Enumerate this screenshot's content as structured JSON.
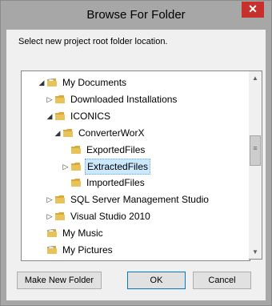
{
  "window": {
    "title": "Browse For Folder",
    "close_glyph": "✕"
  },
  "instruction": "Select new project root folder location.",
  "tree": [
    {
      "label": "My Documents",
      "expander": "◢",
      "icon": "documents-folder-icon",
      "selected": false
    },
    {
      "label": "Downloaded Installations",
      "expander": "▷",
      "icon": "folder-icon",
      "selected": false
    },
    {
      "label": "ICONICS",
      "expander": "◢",
      "icon": "folder-icon",
      "selected": false
    },
    {
      "label": "ConverterWorX",
      "expander": "◢",
      "icon": "folder-icon",
      "selected": false
    },
    {
      "label": "ExportedFiles",
      "expander": "",
      "icon": "folder-icon",
      "selected": false
    },
    {
      "label": "ExtractedFiles",
      "expander": "▷",
      "icon": "folder-icon",
      "selected": true
    },
    {
      "label": "ImportedFiles",
      "expander": "",
      "icon": "folder-icon",
      "selected": false
    },
    {
      "label": "SQL Server Management Studio",
      "expander": "▷",
      "icon": "folder-icon",
      "selected": false
    },
    {
      "label": "Visual Studio 2010",
      "expander": "▷",
      "icon": "folder-icon",
      "selected": false
    },
    {
      "label": "My Music",
      "expander": "",
      "icon": "music-folder-icon",
      "selected": false
    },
    {
      "label": "My Pictures",
      "expander": "",
      "icon": "pictures-folder-icon",
      "selected": false
    }
  ],
  "scrollbar": {
    "up_glyph": "▲",
    "down_glyph": "▼",
    "grip_glyph": "≡"
  },
  "buttons": {
    "new_folder": "Make New Folder",
    "ok": "OK",
    "cancel": "Cancel"
  },
  "colors": {
    "folder": "#e8c25a",
    "selection": "#cce8ff",
    "close": "#c7312b"
  }
}
